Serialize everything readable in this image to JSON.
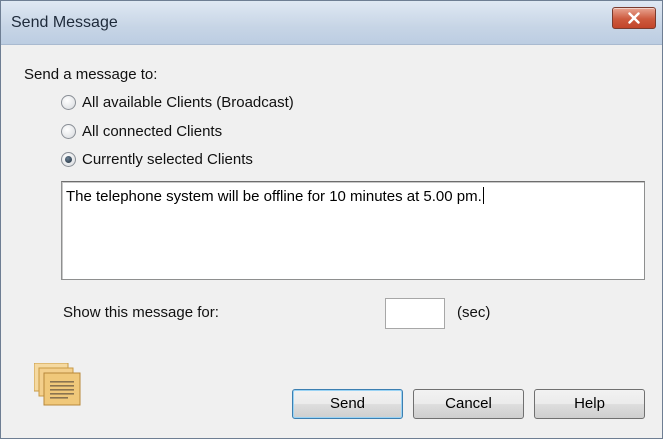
{
  "window": {
    "title": "Send Message"
  },
  "recipients": {
    "label": "Send a message to:",
    "options": [
      {
        "label": "All available Clients (Broadcast)",
        "checked": false
      },
      {
        "label": "All connected Clients",
        "checked": false
      },
      {
        "label": "Currently selected Clients",
        "checked": true
      }
    ]
  },
  "message": {
    "text": "The telephone system will be offline for 10 minutes at 5.00 pm."
  },
  "duration": {
    "label": "Show this message for:",
    "value": "",
    "unit": "(sec)"
  },
  "buttons": {
    "send": "Send",
    "cancel": "Cancel",
    "help": "Help"
  },
  "icons": {
    "close": "close-icon",
    "app": "document-stack-icon"
  },
  "colors": {
    "close_button": "#c9503a",
    "default_button_border": "#3c7fb1",
    "icon_fill": "#f0c87a"
  }
}
